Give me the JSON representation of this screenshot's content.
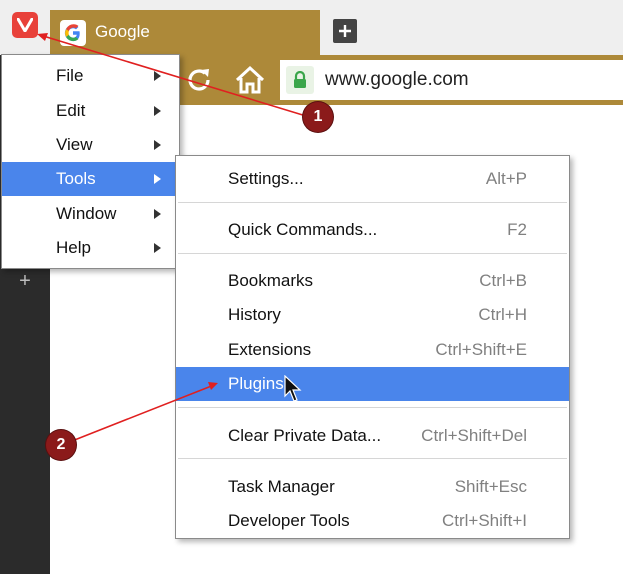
{
  "browser": {
    "tab_title": "Google",
    "url": "www.google.com"
  },
  "main_menu": {
    "items": [
      {
        "label": "File"
      },
      {
        "label": "Edit"
      },
      {
        "label": "View"
      },
      {
        "label": "Tools",
        "highlighted": true
      },
      {
        "label": "Window"
      },
      {
        "label": "Help"
      }
    ]
  },
  "tools_menu": {
    "items": [
      {
        "label": "Settings...",
        "shortcut": "Alt+P"
      },
      {
        "label": "Quick Commands...",
        "shortcut": "F2"
      },
      {
        "label": "Bookmarks",
        "shortcut": "Ctrl+B"
      },
      {
        "label": "History",
        "shortcut": "Ctrl+H"
      },
      {
        "label": "Extensions",
        "shortcut": "Ctrl+Shift+E"
      },
      {
        "label": "Plugins",
        "shortcut": "",
        "highlighted": true
      },
      {
        "label": "Clear Private Data...",
        "shortcut": "Ctrl+Shift+Del"
      },
      {
        "label": "Task Manager",
        "shortcut": "Shift+Esc"
      },
      {
        "label": "Developer Tools",
        "shortcut": "Ctrl+Shift+I"
      }
    ]
  },
  "annotations": {
    "callout_1": "1",
    "callout_2": "2"
  },
  "colors": {
    "accent": "#ad8939",
    "highlight": "#4a85eb",
    "vivaldi_red": "#e8413a",
    "annotation_red": "#e02020",
    "callout": "#8b1a1a"
  },
  "icons": [
    "vivaldi-logo-icon",
    "google-favicon-icon",
    "plus-icon",
    "reload-icon",
    "home-icon",
    "lock-icon",
    "submenu-arrow-icon",
    "mouse-cursor-icon"
  ]
}
